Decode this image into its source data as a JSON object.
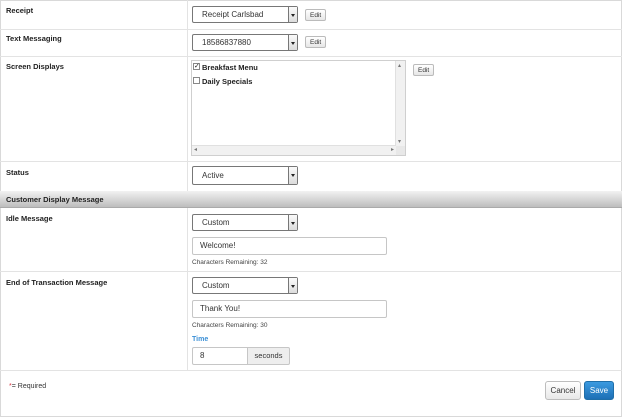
{
  "fields": {
    "receipt": {
      "label": "Receipt",
      "value": "Receipt Carlsbad",
      "edit_label": "Edit"
    },
    "text_messaging": {
      "label": "Text Messaging",
      "value": "18586837880",
      "edit_label": "Edit"
    },
    "screen_displays": {
      "label": "Screen Displays",
      "edit_label": "Edit",
      "items": [
        {
          "label": "Breakfast Menu",
          "checked": true,
          "check_glyph": "✓"
        },
        {
          "label": "Daily Specials",
          "checked": false,
          "check_glyph": ""
        }
      ]
    },
    "status": {
      "label": "Status",
      "value": "Active"
    }
  },
  "customer_display": {
    "section_title": "Customer Display Message",
    "idle": {
      "label": "Idle Message",
      "type_value": "Custom",
      "message_value": "Welcome!",
      "chars_remaining": "Characters Remaining: 32"
    },
    "end_of_transaction": {
      "label": "End of Transaction Message",
      "type_value": "Custom",
      "message_value": "Thank You!",
      "chars_remaining": "Characters Remaining: 30",
      "time_label": "Time",
      "time_value": "8",
      "time_unit": "seconds"
    }
  },
  "footer": {
    "required_star": "*",
    "required_text": "= Required",
    "cancel_label": "Cancel",
    "save_label": "Save"
  },
  "colors": {
    "accent": "#3a8fd6",
    "save_button": "#1d6fb5",
    "required_star": "#d9333f"
  }
}
